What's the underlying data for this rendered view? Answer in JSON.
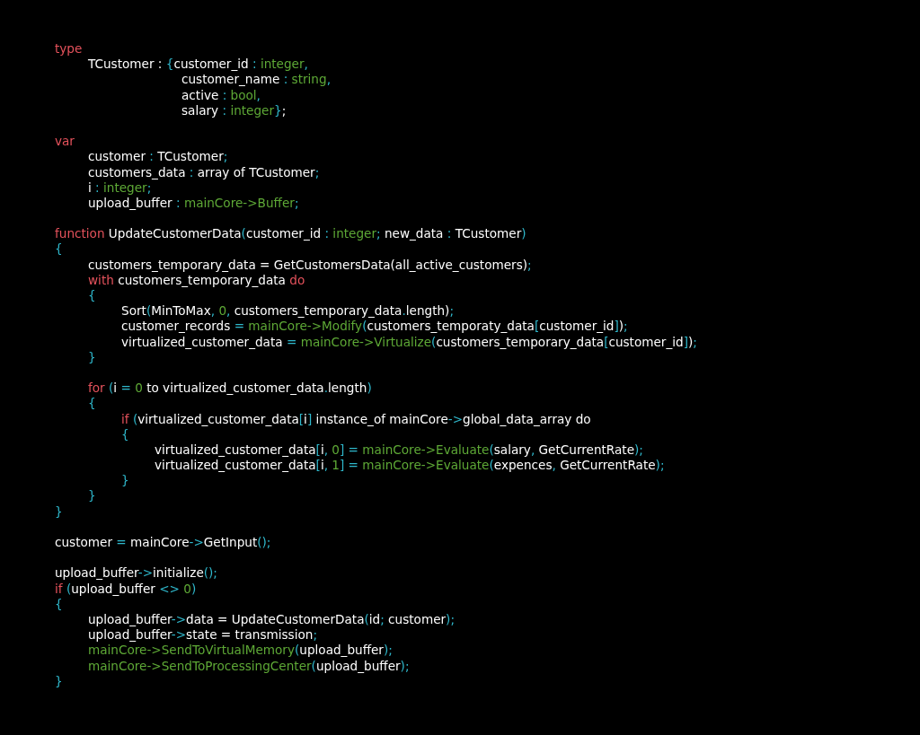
{
  "code_lines": [
    {
      "kind": "code",
      "tokens": [
        {
          "kind": "kw",
          "text": "type"
        }
      ],
      "children": [
        {
          "kind": "code",
          "tokens": [
            {
              "kind": "tx",
              "text": "TCustomer : "
            },
            {
              "kind": "pu",
              "text": "{"
            },
            {
              "kind": "tx",
              "text": "customer_id "
            },
            {
              "kind": "pu",
              "text": ": "
            },
            {
              "kind": "gr",
              "text": "integer"
            },
            {
              "kind": "pu",
              "text": ","
            }
          ]
        },
        {
          "kind": "continuation",
          "tokens": [
            {
              "kind": "tx",
              "text": "customer_name "
            },
            {
              "kind": "pu",
              "text": ": "
            },
            {
              "kind": "gr",
              "text": "string"
            },
            {
              "kind": "pu",
              "text": ","
            }
          ]
        },
        {
          "kind": "continuation",
          "tokens": [
            {
              "kind": "tx",
              "text": "active "
            },
            {
              "kind": "pu",
              "text": ": "
            },
            {
              "kind": "gr",
              "text": "bool"
            },
            {
              "kind": "pu",
              "text": ","
            }
          ]
        },
        {
          "kind": "continuation",
          "tokens": [
            {
              "kind": "tx",
              "text": "salary "
            },
            {
              "kind": "pu",
              "text": ": "
            },
            {
              "kind": "gr",
              "text": "integer"
            },
            {
              "kind": "pu",
              "text": "}"
            },
            {
              "kind": "tx",
              "text": ";"
            }
          ]
        }
      ]
    },
    {
      "kind": "blank"
    },
    {
      "kind": "code",
      "tokens": [
        {
          "kind": "kw",
          "text": "var"
        }
      ],
      "children": [
        {
          "kind": "code",
          "tokens": [
            {
              "kind": "tx",
              "text": "customer "
            },
            {
              "kind": "pu",
              "text": ": "
            },
            {
              "kind": "tx",
              "text": "TCustomer"
            },
            {
              "kind": "pu",
              "text": ";"
            }
          ]
        },
        {
          "kind": "code",
          "tokens": [
            {
              "kind": "tx",
              "text": "customers_data "
            },
            {
              "kind": "pu",
              "text": ": "
            },
            {
              "kind": "tx",
              "text": "array of TCustomer"
            },
            {
              "kind": "pu",
              "text": ";"
            }
          ]
        },
        {
          "kind": "code",
          "tokens": [
            {
              "kind": "tx",
              "text": "i "
            },
            {
              "kind": "pu",
              "text": ": "
            },
            {
              "kind": "gr",
              "text": "integer"
            },
            {
              "kind": "pu",
              "text": ";"
            }
          ]
        },
        {
          "kind": "code",
          "tokens": [
            {
              "kind": "tx",
              "text": "upload_buffer "
            },
            {
              "kind": "pu",
              "text": ": "
            },
            {
              "kind": "gr",
              "text": "mainCore->Buffer"
            },
            {
              "kind": "pu",
              "text": ";"
            }
          ]
        }
      ]
    },
    {
      "kind": "blank"
    },
    {
      "kind": "code",
      "tokens": [
        {
          "kind": "kw",
          "text": "function "
        },
        {
          "kind": "tx",
          "text": "UpdateCustomerData"
        },
        {
          "kind": "pu",
          "text": "("
        },
        {
          "kind": "tx",
          "text": "customer_id "
        },
        {
          "kind": "pu",
          "text": ": "
        },
        {
          "kind": "gr",
          "text": "integer"
        },
        {
          "kind": "pu",
          "text": "; "
        },
        {
          "kind": "tx",
          "text": "new_data "
        },
        {
          "kind": "pu",
          "text": ": "
        },
        {
          "kind": "tx",
          "text": "TCustomer"
        },
        {
          "kind": "pu",
          "text": ")"
        }
      ]
    },
    {
      "kind": "code",
      "tokens": [
        {
          "kind": "pu",
          "text": "{"
        }
      ],
      "children": [
        {
          "kind": "code",
          "tokens": [
            {
              "kind": "tx",
              "text": "customers_temporary_data = GetCustomersData(all_active_customers)"
            },
            {
              "kind": "pu",
              "text": ";"
            }
          ]
        },
        {
          "kind": "code",
          "tokens": [
            {
              "kind": "kw",
              "text": "with "
            },
            {
              "kind": "tx",
              "text": "customers_temporary_data "
            },
            {
              "kind": "kw",
              "text": "do"
            }
          ]
        },
        {
          "kind": "code",
          "tokens": [
            {
              "kind": "pu",
              "text": "{"
            }
          ],
          "children": [
            {
              "kind": "code",
              "tokens": [
                {
                  "kind": "tx",
                  "text": "Sort"
                },
                {
                  "kind": "pu",
                  "text": "("
                },
                {
                  "kind": "tx",
                  "text": "MinToMax"
                },
                {
                  "kind": "pu",
                  "text": ", "
                },
                {
                  "kind": "gr",
                  "text": "0"
                },
                {
                  "kind": "pu",
                  "text": ", "
                },
                {
                  "kind": "tx",
                  "text": "customers_temporary_data"
                },
                {
                  "kind": "pu",
                  "text": "."
                },
                {
                  "kind": "tx",
                  "text": "length)"
                },
                {
                  "kind": "pu",
                  "text": ";"
                }
              ]
            },
            {
              "kind": "code",
              "tokens": [
                {
                  "kind": "tx",
                  "text": "customer_records "
                },
                {
                  "kind": "pu",
                  "text": "= "
                },
                {
                  "kind": "gr",
                  "text": "mainCore->Modify"
                },
                {
                  "kind": "pu",
                  "text": "("
                },
                {
                  "kind": "tx",
                  "text": "customers_temporaty_data"
                },
                {
                  "kind": "pu",
                  "text": "["
                },
                {
                  "kind": "tx",
                  "text": "customer_id"
                },
                {
                  "kind": "pu",
                  "text": "]"
                },
                {
                  "kind": "tx",
                  "text": ")"
                },
                {
                  "kind": "pu",
                  "text": ";"
                }
              ]
            },
            {
              "kind": "code",
              "tokens": [
                {
                  "kind": "tx",
                  "text": "virtualized_customer_data "
                },
                {
                  "kind": "pu",
                  "text": "= "
                },
                {
                  "kind": "gr",
                  "text": "mainCore->Virtualize"
                },
                {
                  "kind": "pu",
                  "text": "("
                },
                {
                  "kind": "tx",
                  "text": "customers_temporary_data"
                },
                {
                  "kind": "pu",
                  "text": "["
                },
                {
                  "kind": "tx",
                  "text": "customer_id"
                },
                {
                  "kind": "pu",
                  "text": "]"
                },
                {
                  "kind": "tx",
                  "text": ")"
                },
                {
                  "kind": "pu",
                  "text": ";"
                }
              ]
            }
          ]
        },
        {
          "kind": "code",
          "tokens": [
            {
              "kind": "pu",
              "text": "}"
            }
          ]
        },
        {
          "kind": "blank"
        },
        {
          "kind": "code",
          "tokens": [
            {
              "kind": "kw",
              "text": "for "
            },
            {
              "kind": "pu",
              "text": "("
            },
            {
              "kind": "tx",
              "text": "i "
            },
            {
              "kind": "pu",
              "text": "= "
            },
            {
              "kind": "gr",
              "text": "0"
            },
            {
              "kind": "tx",
              "text": " to virtualized_customer_data"
            },
            {
              "kind": "pu",
              "text": "."
            },
            {
              "kind": "tx",
              "text": "length"
            },
            {
              "kind": "pu",
              "text": ")"
            }
          ]
        },
        {
          "kind": "code",
          "tokens": [
            {
              "kind": "pu",
              "text": "{"
            }
          ],
          "children": [
            {
              "kind": "code",
              "tokens": [
                {
                  "kind": "kw",
                  "text": "if "
                },
                {
                  "kind": "pu",
                  "text": "("
                },
                {
                  "kind": "tx",
                  "text": "virtualized_customer_data"
                },
                {
                  "kind": "pu",
                  "text": "["
                },
                {
                  "kind": "tx",
                  "text": "i"
                },
                {
                  "kind": "pu",
                  "text": "]"
                },
                {
                  "kind": "tx",
                  "text": " instance_of mainCore"
                },
                {
                  "kind": "pu",
                  "text": "->"
                },
                {
                  "kind": "tx",
                  "text": "global_data_array do"
                }
              ]
            },
            {
              "kind": "code",
              "tokens": [
                {
                  "kind": "pu",
                  "text": "{"
                }
              ],
              "children": [
                {
                  "kind": "code",
                  "tokens": [
                    {
                      "kind": "tx",
                      "text": "virtualized_customer_data"
                    },
                    {
                      "kind": "pu",
                      "text": "["
                    },
                    {
                      "kind": "tx",
                      "text": "i"
                    },
                    {
                      "kind": "pu",
                      "text": ", "
                    },
                    {
                      "kind": "gr",
                      "text": "0"
                    },
                    {
                      "kind": "pu",
                      "text": "] = "
                    },
                    {
                      "kind": "gr",
                      "text": "mainCore->Evaluate"
                    },
                    {
                      "kind": "pu",
                      "text": "("
                    },
                    {
                      "kind": "tx",
                      "text": "salary"
                    },
                    {
                      "kind": "pu",
                      "text": ", "
                    },
                    {
                      "kind": "tx",
                      "text": "GetCurrentRate"
                    },
                    {
                      "kind": "pu",
                      "text": ");"
                    }
                  ]
                },
                {
                  "kind": "code",
                  "tokens": [
                    {
                      "kind": "tx",
                      "text": "virtualized_customer_data"
                    },
                    {
                      "kind": "pu",
                      "text": "["
                    },
                    {
                      "kind": "tx",
                      "text": "i"
                    },
                    {
                      "kind": "pu",
                      "text": ", "
                    },
                    {
                      "kind": "gr",
                      "text": "1"
                    },
                    {
                      "kind": "pu",
                      "text": "] = "
                    },
                    {
                      "kind": "gr",
                      "text": "mainCore->Evaluate"
                    },
                    {
                      "kind": "pu",
                      "text": "("
                    },
                    {
                      "kind": "tx",
                      "text": "expences"
                    },
                    {
                      "kind": "pu",
                      "text": ", "
                    },
                    {
                      "kind": "tx",
                      "text": "GetCurrentRate"
                    },
                    {
                      "kind": "pu",
                      "text": ");"
                    }
                  ]
                }
              ]
            },
            {
              "kind": "code",
              "tokens": [
                {
                  "kind": "pu",
                  "text": "}"
                }
              ]
            }
          ]
        },
        {
          "kind": "code",
          "tokens": [
            {
              "kind": "pu",
              "text": "}"
            }
          ]
        }
      ]
    },
    {
      "kind": "code",
      "tokens": [
        {
          "kind": "pu",
          "text": "}"
        }
      ]
    },
    {
      "kind": "blank"
    },
    {
      "kind": "code",
      "tokens": [
        {
          "kind": "tx",
          "text": "customer "
        },
        {
          "kind": "pu",
          "text": "= "
        },
        {
          "kind": "tx",
          "text": "mainCore"
        },
        {
          "kind": "pu",
          "text": "->"
        },
        {
          "kind": "tx",
          "text": "GetInput"
        },
        {
          "kind": "pu",
          "text": "();"
        }
      ]
    },
    {
      "kind": "blank"
    },
    {
      "kind": "code",
      "tokens": [
        {
          "kind": "tx",
          "text": "upload_buffer"
        },
        {
          "kind": "pu",
          "text": "->"
        },
        {
          "kind": "tx",
          "text": "initialize"
        },
        {
          "kind": "pu",
          "text": "();"
        }
      ]
    },
    {
      "kind": "code",
      "tokens": [
        {
          "kind": "kw",
          "text": "if "
        },
        {
          "kind": "pu",
          "text": "("
        },
        {
          "kind": "tx",
          "text": "upload_buffer "
        },
        {
          "kind": "pu",
          "text": "<> "
        },
        {
          "kind": "gr",
          "text": "0"
        },
        {
          "kind": "pu",
          "text": ")"
        }
      ]
    },
    {
      "kind": "code",
      "tokens": [
        {
          "kind": "pu",
          "text": "{"
        }
      ],
      "children": [
        {
          "kind": "code",
          "tokens": [
            {
              "kind": "tx",
              "text": "upload_buffer"
            },
            {
              "kind": "pu",
              "text": "->"
            },
            {
              "kind": "tx",
              "text": "data = UpdateCustomerData"
            },
            {
              "kind": "pu",
              "text": "("
            },
            {
              "kind": "tx",
              "text": "id"
            },
            {
              "kind": "pu",
              "text": "; "
            },
            {
              "kind": "tx",
              "text": "customer"
            },
            {
              "kind": "pu",
              "text": ");"
            }
          ]
        },
        {
          "kind": "code",
          "tokens": [
            {
              "kind": "tx",
              "text": "upload_buffer"
            },
            {
              "kind": "pu",
              "text": "->"
            },
            {
              "kind": "tx",
              "text": "state = transmission"
            },
            {
              "kind": "pu",
              "text": ";"
            }
          ]
        },
        {
          "kind": "code",
          "tokens": [
            {
              "kind": "gr",
              "text": "mainCore->SendToVirtualMemory"
            },
            {
              "kind": "pu",
              "text": "("
            },
            {
              "kind": "tx",
              "text": "upload_buffer"
            },
            {
              "kind": "pu",
              "text": ");"
            }
          ]
        },
        {
          "kind": "code",
          "tokens": [
            {
              "kind": "gr",
              "text": "mainCore->SendToProcessingCenter"
            },
            {
              "kind": "pu",
              "text": "("
            },
            {
              "kind": "tx",
              "text": "upload_buffer"
            },
            {
              "kind": "pu",
              "text": ");"
            }
          ]
        }
      ]
    },
    {
      "kind": "code",
      "tokens": [
        {
          "kind": "pu",
          "text": "}"
        }
      ]
    }
  ]
}
